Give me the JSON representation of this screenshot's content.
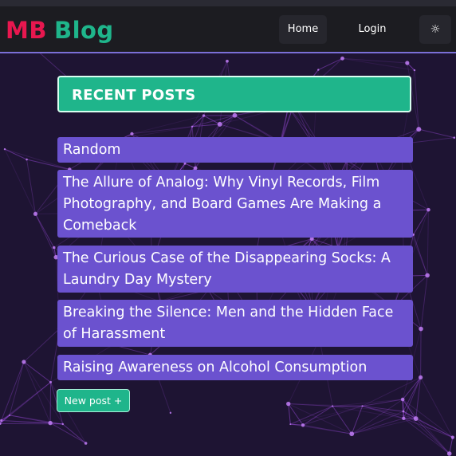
{
  "navbar": {
    "logo_primary": "MB",
    "logo_secondary": "Blog",
    "home_label": "Home",
    "login_label": "Login",
    "theme_toggle_glyph": "☼"
  },
  "panel": {
    "title": "RECENT POSTS"
  },
  "posts": [
    "Random",
    "The Allure of Analog: Why Vinyl Records, Film Photography, and Board Games Are Making a Comeback",
    "The Curious Case of the Disappearing Socks: A Laundry Day Mystery",
    "Breaking the Silence: Men and the Hidden Face of Harassment",
    "Raising Awareness on Alcohol Consumption"
  ],
  "new_post_label": "New post +",
  "colors": {
    "brand_red": "#e8174f",
    "brand_green": "#1fb58b",
    "post_background": "#6b52cf",
    "page_background": "#1e1433",
    "network_lines": "#a24ee6"
  },
  "icons": {
    "theme_toggle": "sun-icon"
  }
}
